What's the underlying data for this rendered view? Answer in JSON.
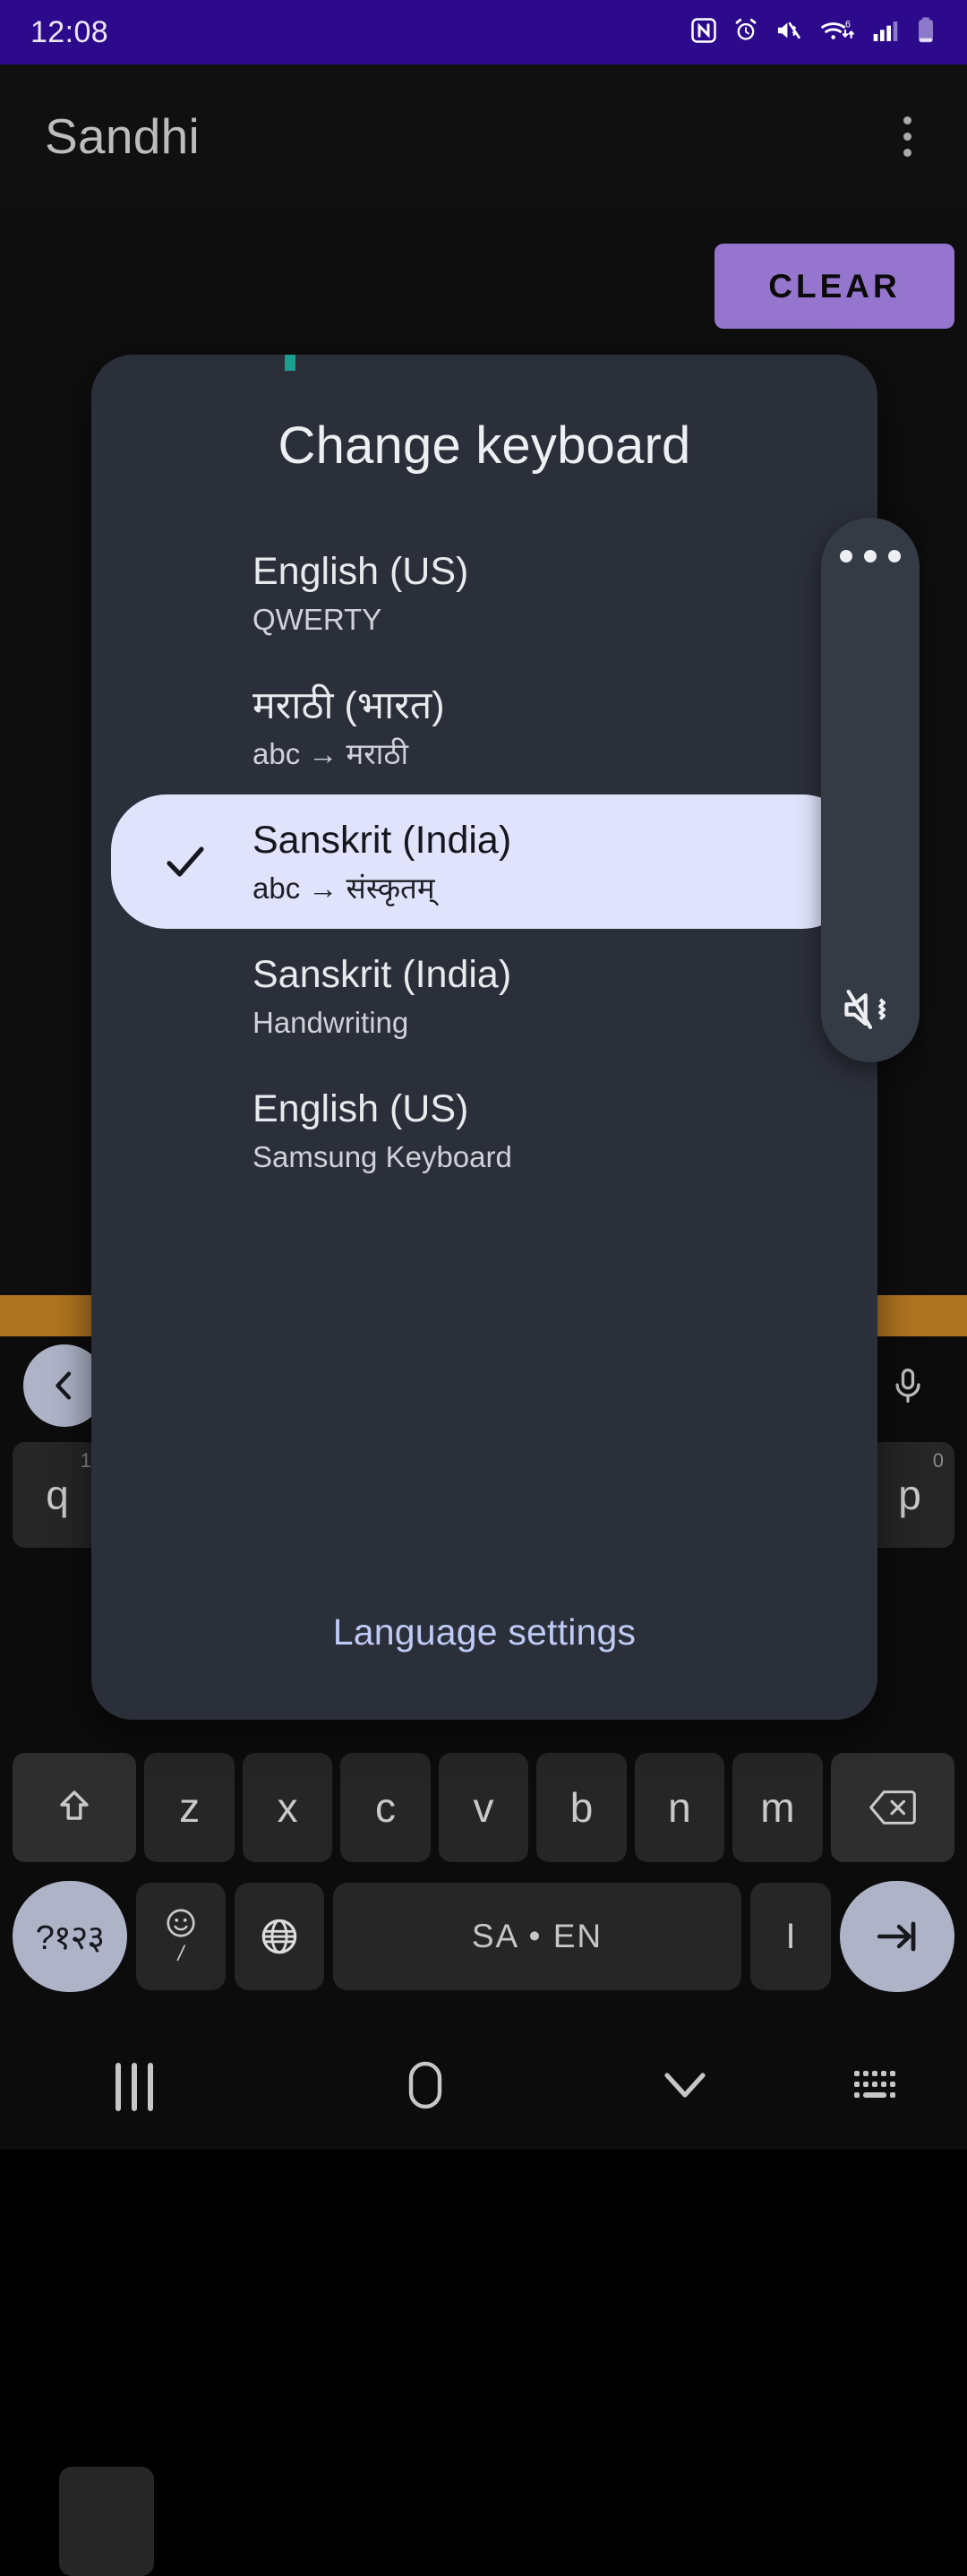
{
  "statusbar": {
    "time": "12:08",
    "icons": [
      "nfc-icon",
      "alarm-icon",
      "mute-vibrate-icon",
      "wifi-6-icon",
      "signal-bars-icon",
      "battery-icon"
    ]
  },
  "appbar": {
    "title": "Sandhi",
    "overflow_label": "more-options"
  },
  "app": {
    "clear_label": "CLEAR"
  },
  "dialog": {
    "title": "Change keyboard",
    "items": [
      {
        "name": "English (US)",
        "subtitle": "QWERTY",
        "selected": false
      },
      {
        "name": "मराठी (भारत)",
        "subtitle": "abc → मराठी",
        "selected": false
      },
      {
        "name": "Sanskrit (India)",
        "subtitle": "abc → संस्कृतम्",
        "selected": true
      },
      {
        "name": "Sanskrit (India)",
        "subtitle": "Handwriting",
        "selected": false
      },
      {
        "name": "English (US)",
        "subtitle": "Samsung Keyboard",
        "selected": false
      }
    ],
    "footer_link": "Language settings"
  },
  "side_panel": {
    "handle_label": "panel-handle",
    "mute_label": "mute-vibrate"
  },
  "keyboard": {
    "back_label": "back",
    "mic_label": "voice-input",
    "row1": [
      {
        "key": "q",
        "sup": "1"
      },
      {
        "key": "p",
        "sup": "0"
      }
    ],
    "row3": [
      "z",
      "x",
      "c",
      "v",
      "b",
      "n",
      "m"
    ],
    "shift_label": "shift",
    "delete_label": "backspace",
    "numeric_label": "?१२३",
    "emoji_label": "/",
    "globe_label": "language-switch",
    "space_label": "SA • EN",
    "bar_label": "I",
    "enter_label": "tab"
  },
  "navbar": {
    "recents_label": "recents",
    "home_label": "home",
    "hide_keyboard_label": "hide-keyboard",
    "switch_keyboard_label": "switch-keyboard"
  },
  "colors": {
    "statusbar_bg": "#2D0A8C",
    "accent_purple": "#9575CD",
    "dialog_bg": "#2B2F39",
    "selected_bg": "#E0E3FB",
    "link": "#BFCBF5",
    "orange_band": "#B07520",
    "key_accent": "#AEB3C8"
  }
}
